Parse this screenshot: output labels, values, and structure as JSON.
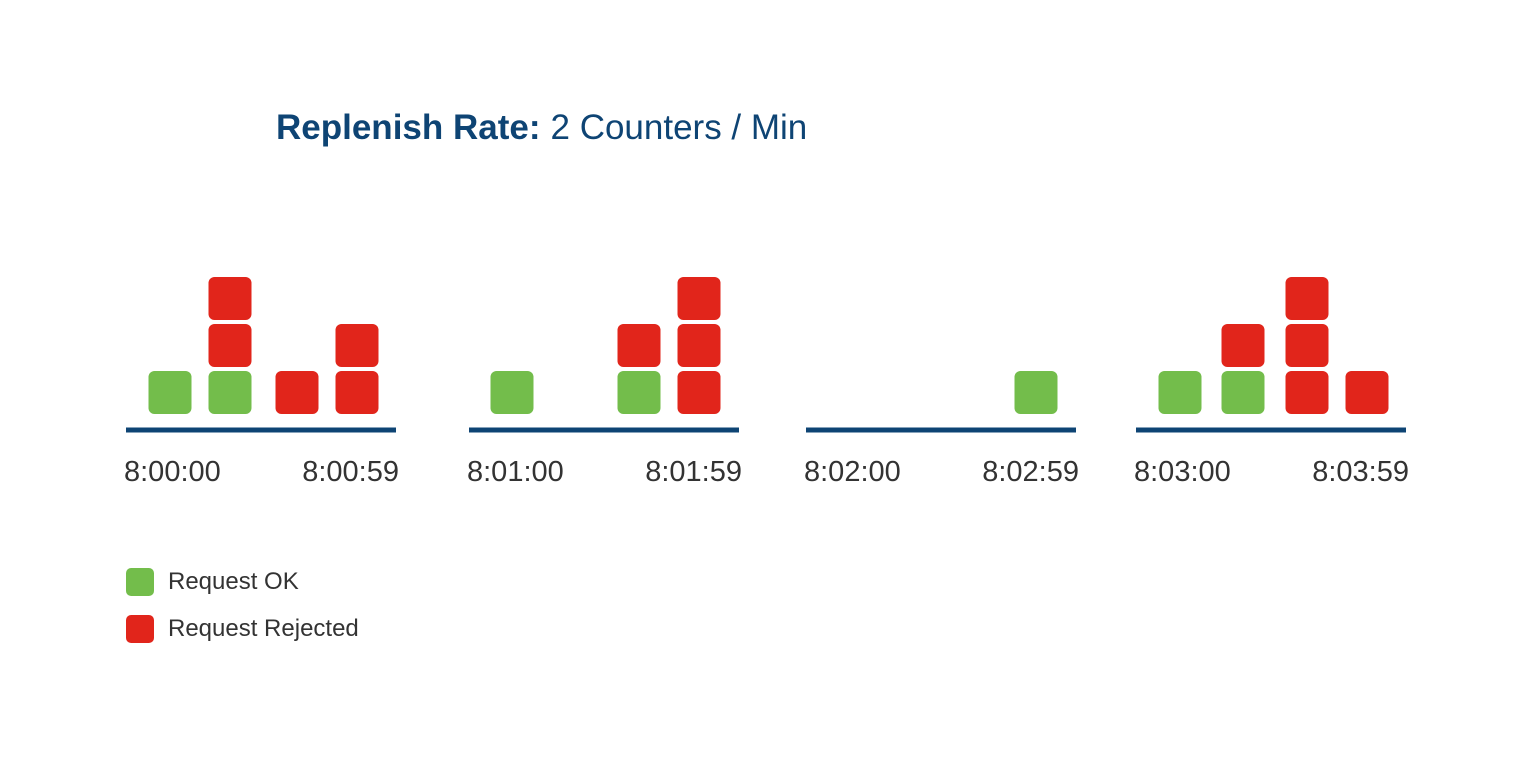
{
  "title": {
    "label": "Replenish Rate:",
    "value": "2 Counters / Min"
  },
  "colors": {
    "ok": "#73bd4b",
    "rejected": "#e1251b",
    "axis": "#0e4474",
    "text": "#333333"
  },
  "minutes": [
    {
      "start_label": "8:00:00",
      "end_label": "8:00:59",
      "stacks": [
        [
          "ok"
        ],
        [
          "ok",
          "rejected",
          "rejected"
        ],
        [
          "rejected"
        ],
        [
          "rejected",
          "rejected"
        ]
      ]
    },
    {
      "start_label": "8:01:00",
      "end_label": "8:01:59",
      "stacks": [
        [
          "ok"
        ],
        [
          "ok",
          "rejected"
        ],
        [
          "rejected",
          "rejected",
          "rejected"
        ]
      ]
    },
    {
      "start_label": "8:02:00",
      "end_label": "8:02:59",
      "stacks": [
        [
          "ok"
        ]
      ]
    },
    {
      "start_label": "8:03:00",
      "end_label": "8:03:59",
      "stacks": [
        [
          "ok"
        ],
        [
          "ok",
          "rejected"
        ],
        [
          "rejected",
          "rejected",
          "rejected"
        ],
        [
          "rejected"
        ]
      ]
    }
  ],
  "legend": [
    {
      "key": "ok",
      "label": "Request OK"
    },
    {
      "key": "rejected",
      "label": "Request Rejected"
    }
  ]
}
